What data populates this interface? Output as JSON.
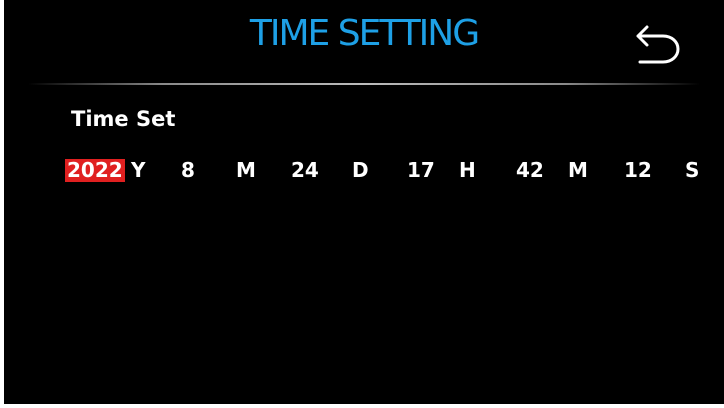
{
  "header": {
    "title": "TIME SETTING",
    "back_icon": "back-arrow-icon"
  },
  "section": {
    "label": "Time Set"
  },
  "time": {
    "year": {
      "value": "2022",
      "unit": "Y",
      "selected": true
    },
    "month": {
      "value": "8",
      "unit": "M"
    },
    "day": {
      "value": "24",
      "unit": "D"
    },
    "hour": {
      "value": "17",
      "unit": "H"
    },
    "minute": {
      "value": "42",
      "unit": "M"
    },
    "second": {
      "value": "12",
      "unit": "S"
    }
  },
  "colors": {
    "background": "#000000",
    "title": "#1ea0e6",
    "text": "#ffffff",
    "selected_highlight": "#e02020"
  }
}
